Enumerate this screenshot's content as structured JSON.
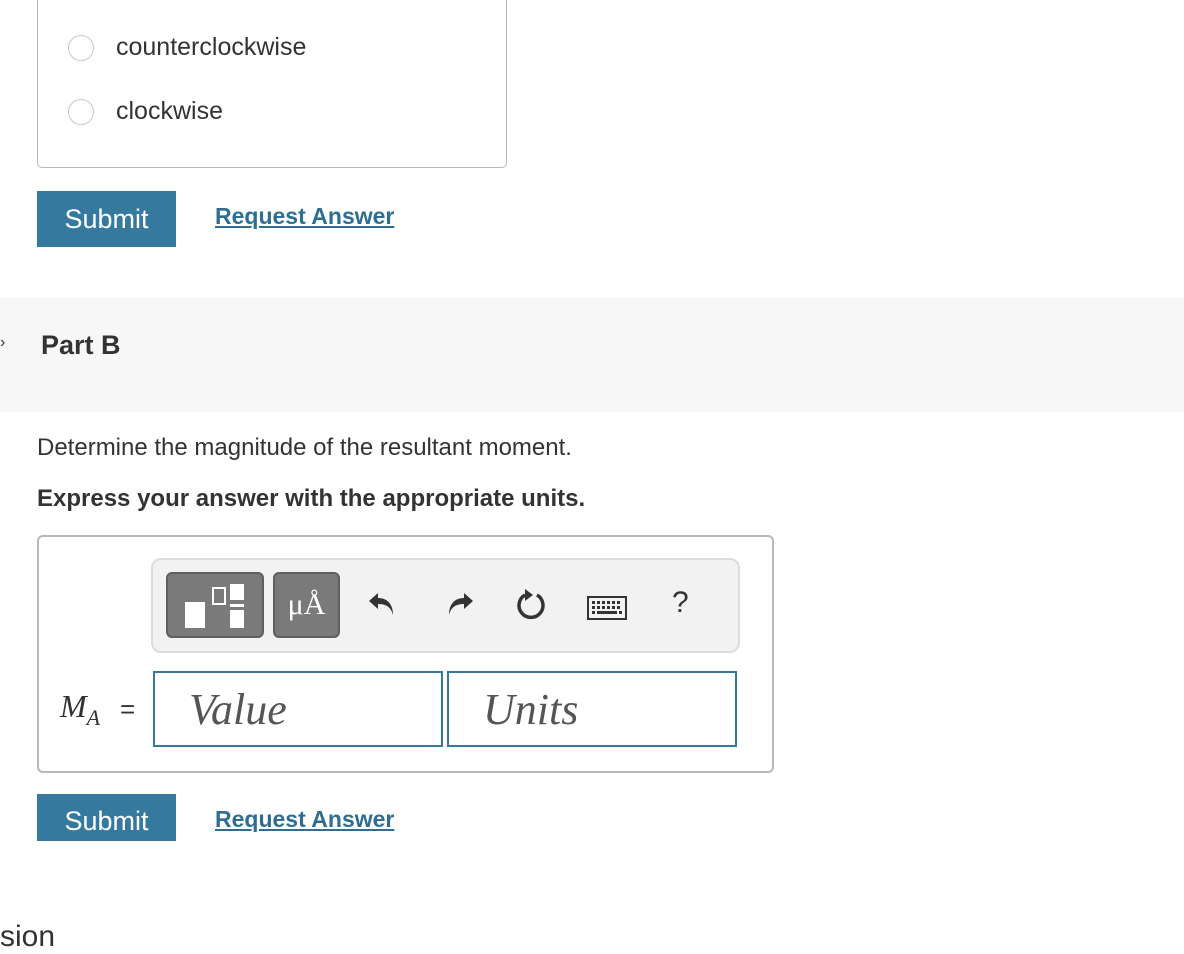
{
  "part_a": {
    "options": [
      {
        "label": "counterclockwise"
      },
      {
        "label": "clockwise"
      }
    ],
    "submit_label": "Submit",
    "request_label": "Request Answer"
  },
  "part_b": {
    "title": "Part B",
    "prompt": "Determine the magnitude of the resultant moment.",
    "instruction": "Express your answer with the appropriate units.",
    "variable": {
      "main": "M",
      "sub": "A"
    },
    "equals": "=",
    "value_placeholder": "Value",
    "units_placeholder": "Units",
    "toolbar": {
      "units_button_text": "μÅ",
      "help_text": "?",
      "icons": [
        "fraction-template-icon",
        "units-icon",
        "undo-icon",
        "redo-icon",
        "reset-icon",
        "keyboard-icon",
        "help-icon"
      ]
    },
    "submit_label": "Submit",
    "request_label": "Request Answer"
  },
  "footer": {
    "partial_text": "sion"
  },
  "colors": {
    "accent": "#35799f",
    "link": "#2f6e93",
    "band": "#f7f7f7"
  }
}
